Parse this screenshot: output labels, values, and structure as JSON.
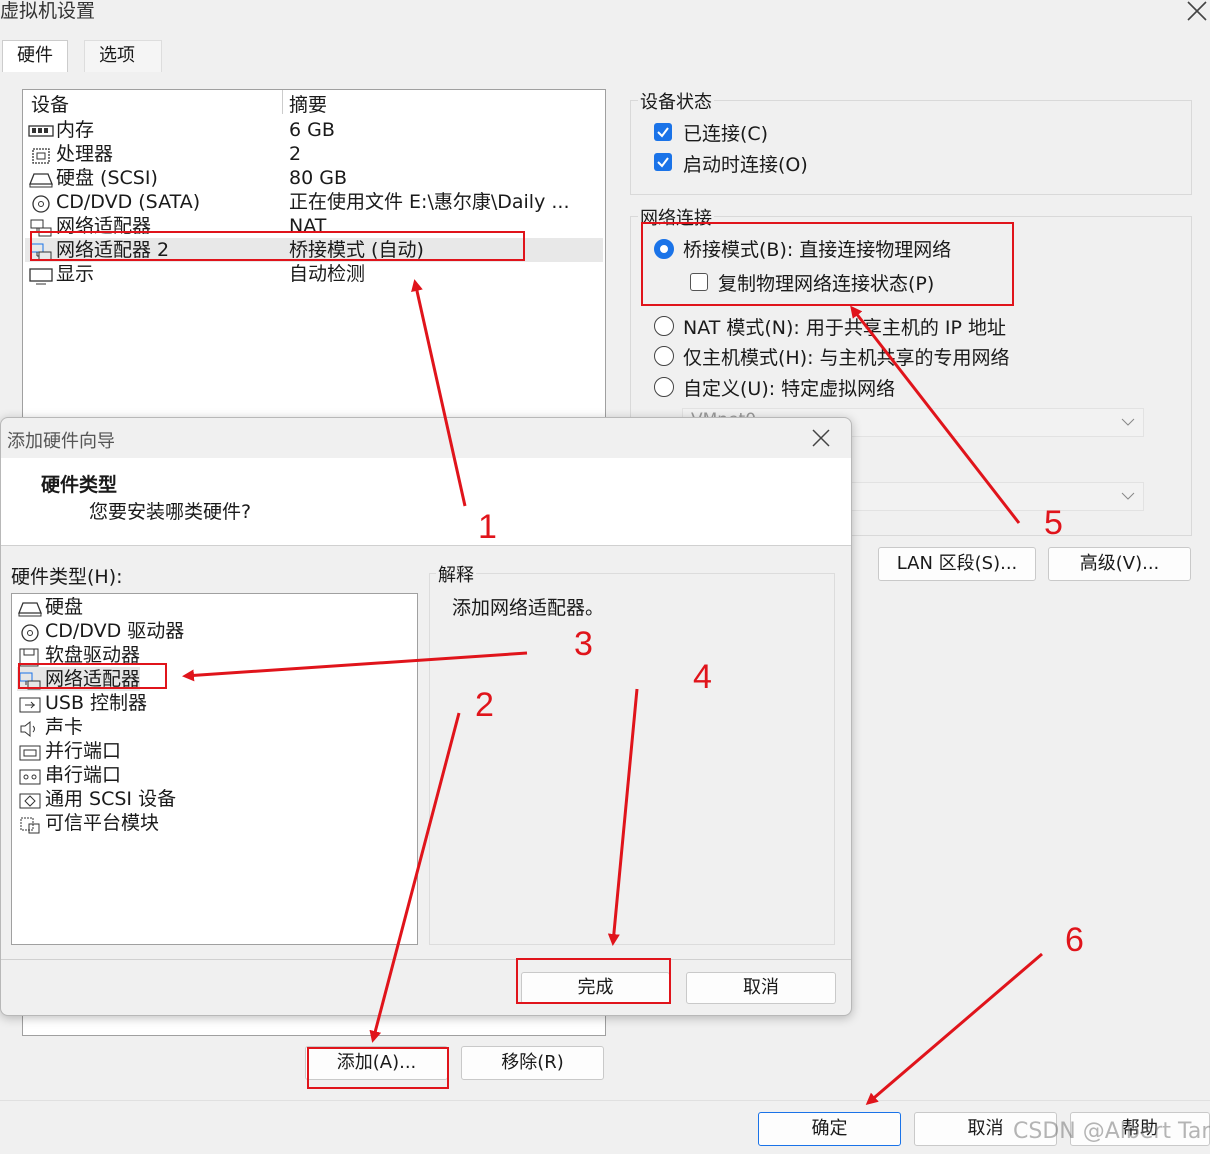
{
  "window": {
    "title": "虚拟机设置"
  },
  "tabs": [
    {
      "label": "硬件"
    },
    {
      "label": "选项"
    }
  ],
  "device_table": {
    "headers": {
      "device": "设备",
      "summary": "摘要"
    },
    "rows": [
      {
        "icon": "memory-icon",
        "device": "内存",
        "summary": "6 GB"
      },
      {
        "icon": "processor-icon",
        "device": "处理器",
        "summary": "2"
      },
      {
        "icon": "hard-disk-icon",
        "device": "硬盘 (SCSI)",
        "summary": "80 GB"
      },
      {
        "icon": "cd-dvd-icon",
        "device": "CD/DVD (SATA)",
        "summary": "正在使用文件 E:\\惠尔康\\Daily ..."
      },
      {
        "icon": "network-adapter-icon",
        "device": "网络适配器",
        "summary": "NAT"
      },
      {
        "icon": "network-adapter-icon",
        "device": "网络适配器 2",
        "summary": "桥接模式 (自动)",
        "selected": true
      },
      {
        "icon": "display-icon",
        "device": "显示",
        "summary": "自动检测"
      }
    ]
  },
  "device_status": {
    "legend": "设备状态",
    "connected": {
      "label": "已连接(C)",
      "checked": true
    },
    "connect_at_power_on": {
      "label": "启动时连接(O)",
      "checked": true
    }
  },
  "network_connection": {
    "legend": "网络连接",
    "bridged": {
      "label": "桥接模式(B): 直接连接物理网络",
      "selected": true
    },
    "replicate": {
      "label": "复制物理网络连接状态(P)",
      "checked": false
    },
    "nat": {
      "label": "NAT 模式(N): 用于共享主机的 IP 地址",
      "selected": false
    },
    "host_only": {
      "label": "仅主机模式(H): 与主机共享的专用网络",
      "selected": false
    },
    "custom": {
      "label": "自定义(U): 特定虚拟网络",
      "selected": false
    },
    "custom_dropdown_value": "VMnet0"
  },
  "lan_segment_button": "LAN 区段(S)...",
  "advanced_button": "高级(V)...",
  "add_button": "添加(A)...",
  "remove_button": "移除(R)",
  "footer": {
    "ok": "确定",
    "cancel": "取消",
    "help": "帮助"
  },
  "watermark": "CSDN @Albert Tan",
  "wizard": {
    "title": "添加硬件向导",
    "heading": "硬件类型",
    "subheading": "您要安装哪类硬件?",
    "list_label": "硬件类型(H):",
    "items": [
      {
        "icon": "hard-disk-icon",
        "label": "硬盘"
      },
      {
        "icon": "cd-dvd-icon",
        "label": "CD/DVD 驱动器"
      },
      {
        "icon": "floppy-icon",
        "label": "软盘驱动器"
      },
      {
        "icon": "network-adapter-icon",
        "label": "网络适配器",
        "selected": true
      },
      {
        "icon": "usb-icon",
        "label": "USB 控制器"
      },
      {
        "icon": "sound-icon",
        "label": "声卡"
      },
      {
        "icon": "parallel-port-icon",
        "label": "并行端口"
      },
      {
        "icon": "serial-port-icon",
        "label": "串行端口"
      },
      {
        "icon": "scsi-icon",
        "label": "通用 SCSI 设备"
      },
      {
        "icon": "tpm-icon",
        "label": "可信平台模块"
      }
    ],
    "explain_legend": "解释",
    "explain_text": "添加网络适配器。",
    "finish": "完成",
    "cancel": "取消"
  },
  "annotations": {
    "numbers": [
      "1",
      "2",
      "3",
      "4",
      "5",
      "6"
    ],
    "color": "#e0141b"
  },
  "colors": {
    "accent": "#1a73e8",
    "annotation": "#e0141b"
  }
}
